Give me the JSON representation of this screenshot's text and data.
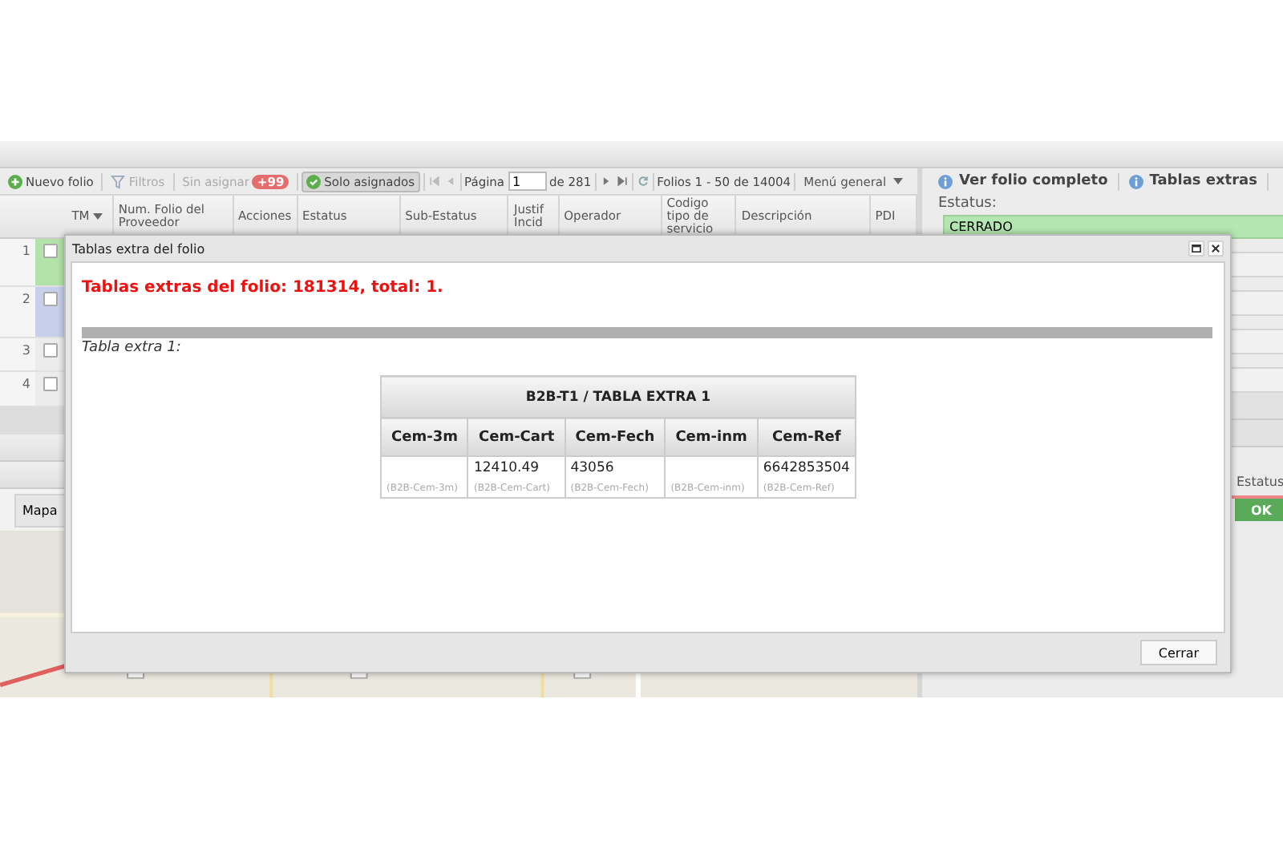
{
  "toolbar": {
    "items": [
      {
        "kind": "add",
        "label": "Nuevo folio",
        "disabled": false,
        "selected": false
      },
      {
        "kind": "filter",
        "label": "Filtros",
        "disabled": true,
        "selected": false
      },
      {
        "kind": "counter",
        "label": "Sin asignar",
        "badge": "+99",
        "disabled": true,
        "selected": false
      },
      {
        "kind": "toggle",
        "label": "Solo asignados",
        "disabled": false,
        "selected": true
      }
    ],
    "page_label": "Página",
    "page_value": "1",
    "page_total": "de 281",
    "range": "Folios 1 - 50 de 14004",
    "menu": "Menú general"
  },
  "grid": {
    "columns": [
      "TM",
      "Num. Folio del Proveedor",
      "Acciones",
      "Estatus",
      "Sub-Estatus",
      "Justif Incid",
      "Operador",
      "Codigo tipo de servicio",
      "Descripción",
      "PDI"
    ],
    "rows": [
      {
        "number": "1",
        "color": "#b4e3a9"
      },
      {
        "number": "2",
        "color": "#c8cfea"
      },
      {
        "number": "3",
        "color": "#ececec"
      },
      {
        "number": "4",
        "color": "#ececec"
      }
    ]
  },
  "lower_panel": {
    "tab": "Mapa"
  },
  "detail": {
    "actions": [
      "Ver folio completo",
      "Tablas extras"
    ],
    "status_label": "Estatus:",
    "status_value": "CERRADO",
    "list_header": "Estatus",
    "ok_button": "OK"
  },
  "dialog": {
    "title": "Tablas extra del folio",
    "heading": "Tablas extras del folio: 181314, total: 1.",
    "subtitle": "Tabla extra 1:",
    "table": {
      "title": "B2B-T1 / TABLA EXTRA 1",
      "columns": [
        {
          "label": "Cem-3m",
          "hint": "(B2B-Cem-3m)"
        },
        {
          "label": "Cem-Cart",
          "value": "12410.49",
          "hint": "(B2B-Cem-Cart)"
        },
        {
          "label": "Cem-Fech",
          "value": "43056",
          "hint": "(B2B-Cem-Fech)"
        },
        {
          "label": "Cem-inm",
          "hint": "(B2B-Cem-inm)"
        },
        {
          "label": "Cem-Ref",
          "value": "6642853504",
          "hint": "(B2B-Cem-Ref)"
        }
      ]
    },
    "close_button": "Cerrar"
  }
}
